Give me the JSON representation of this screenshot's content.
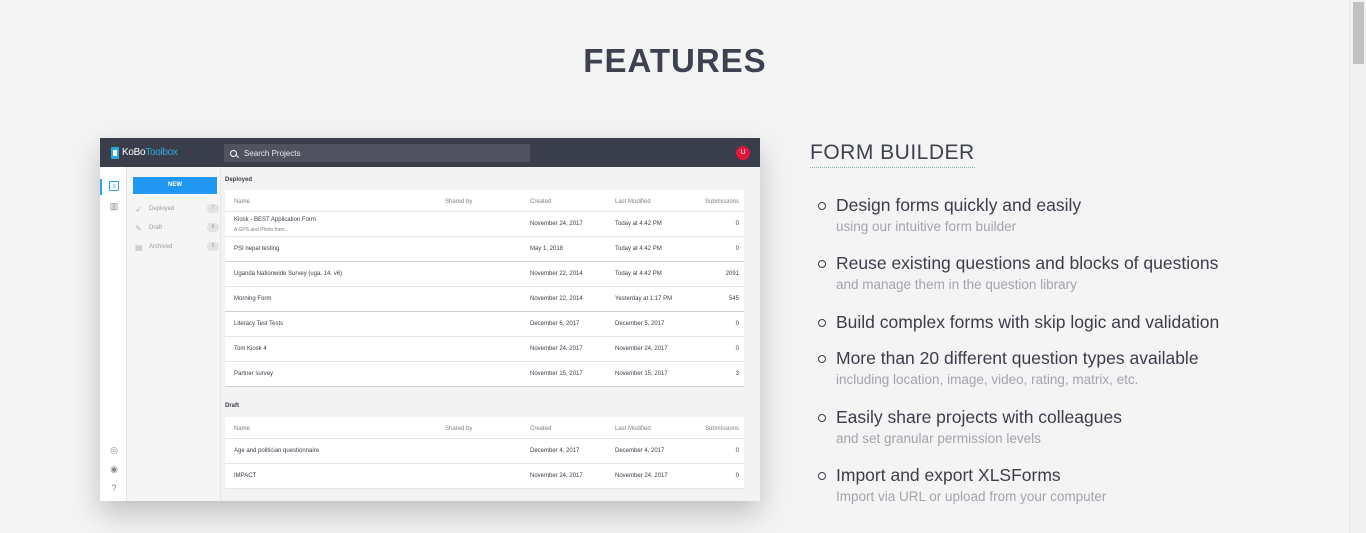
{
  "section_title": "FEATURES",
  "screenshot": {
    "logo_part1": "KoBo",
    "logo_part2": "Toolbox",
    "search_placeholder": "Search Projects",
    "avatar_letter": "U",
    "new_button": "NEW",
    "sidebar": [
      {
        "label": "Deployed",
        "count": "7"
      },
      {
        "label": "Draft",
        "count": "8"
      },
      {
        "label": "Archived",
        "count": "5"
      }
    ],
    "columns": {
      "name": "Name",
      "shared": "Shared by",
      "created": "Created",
      "modified": "Last Modified",
      "submissions": "Submissions"
    },
    "deployed_label": "Deployed",
    "deployed_rows": [
      {
        "name": "Kiosk - BEST Application Form",
        "desc": "A GPS and Photo form.",
        "created": "November 24, 2017",
        "modified": "Today at 4:42 PM",
        "submissions": "0"
      },
      {
        "name": "PSI nepal testing",
        "created": "May 1, 2018",
        "modified": "Today at 4:42 PM",
        "submissions": "0"
      },
      {
        "name": "Uganda Nationwide Survey (uga. 14. v6)",
        "created": "November 22, 2014",
        "modified": "Today at 4:42 PM",
        "submissions": "2091"
      },
      {
        "name": "Morning Form",
        "created": "November 22, 2014",
        "modified": "Yesterday at 1:17 PM",
        "submissions": "545"
      },
      {
        "name": "Literacy Test Tests",
        "created": "December 6, 2017",
        "modified": "December 5, 2017",
        "submissions": "0"
      },
      {
        "name": "Tom Kiosk 4",
        "created": "November 24, 2017",
        "modified": "November 24, 2017",
        "submissions": "0"
      },
      {
        "name": "Partner survey",
        "created": "November 15, 2017",
        "modified": "November 15, 2017",
        "submissions": "3"
      }
    ],
    "draft_label": "Draft",
    "draft_rows": [
      {
        "name": "Age and politician questionnaire",
        "created": "December 4, 2017",
        "modified": "December 4, 2017",
        "submissions": "0"
      },
      {
        "name": "IMPACT",
        "created": "November 24, 2017",
        "modified": "November 24, 2017",
        "submissions": "0"
      }
    ]
  },
  "form_builder": {
    "title": "FORM BUILDER",
    "features": [
      {
        "main": "Design forms quickly and easily",
        "sub": "using our intuitive form builder"
      },
      {
        "main": "Reuse existing questions and blocks of questions",
        "sub": "and manage them in the question library"
      },
      {
        "main": "Build complex forms with skip logic and validation",
        "sub": ""
      },
      {
        "main": "More than 20 different question types available",
        "sub": "including location, image, video, rating, matrix, etc."
      },
      {
        "main": "Easily share projects with colleagues",
        "sub": "and set granular permission levels"
      },
      {
        "main": "Import and export XLSForms",
        "sub": "Import via URL or upload from your computer"
      }
    ]
  }
}
